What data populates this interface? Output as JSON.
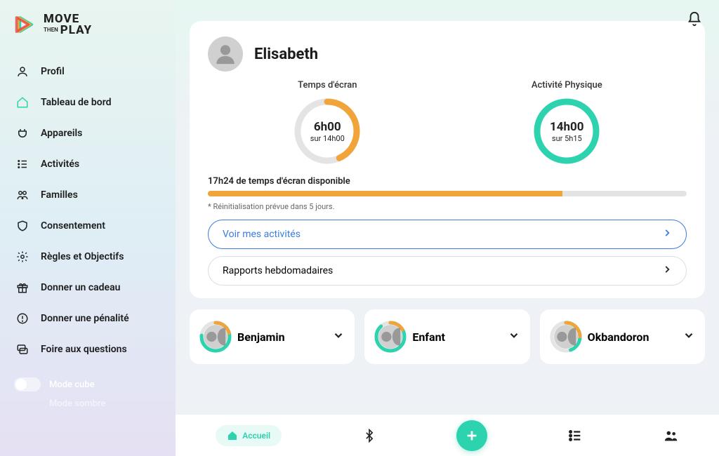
{
  "brand": {
    "line1": "MOVE",
    "line2": "PLAY",
    "then": "THEN"
  },
  "sidebar": {
    "items": [
      {
        "label": "Profil"
      },
      {
        "label": "Tableau de bord"
      },
      {
        "label": "Appareils"
      },
      {
        "label": "Activités"
      },
      {
        "label": "Familles"
      },
      {
        "label": "Consentement"
      },
      {
        "label": "Règles et Objectifs"
      },
      {
        "label": "Donner un cadeau"
      },
      {
        "label": "Donner une pénalité"
      },
      {
        "label": "Foire aux questions"
      }
    ],
    "toggle_cube": "Mode cube",
    "toggle_dark": "Mode sombre"
  },
  "main": {
    "username": "Elisabeth",
    "gauge1": {
      "title": "Temps d'écran",
      "value": "6h00",
      "sub": "sur 14h00"
    },
    "gauge2": {
      "title": "Activité Physique",
      "value": "14h00",
      "sub": "sur 5h15"
    },
    "available": "17h24 de temps d'écran disponible",
    "reset_note": "* Réinitialisation prévue dans 5 jours.",
    "action_activities": "Voir mes activités",
    "action_reports": "Rapports hebdomadaires"
  },
  "kids": [
    {
      "name": "Benjamin"
    },
    {
      "name": "Enfant"
    },
    {
      "name": "Okbandoron"
    }
  ],
  "bottomnav": {
    "home": "Accueil"
  }
}
